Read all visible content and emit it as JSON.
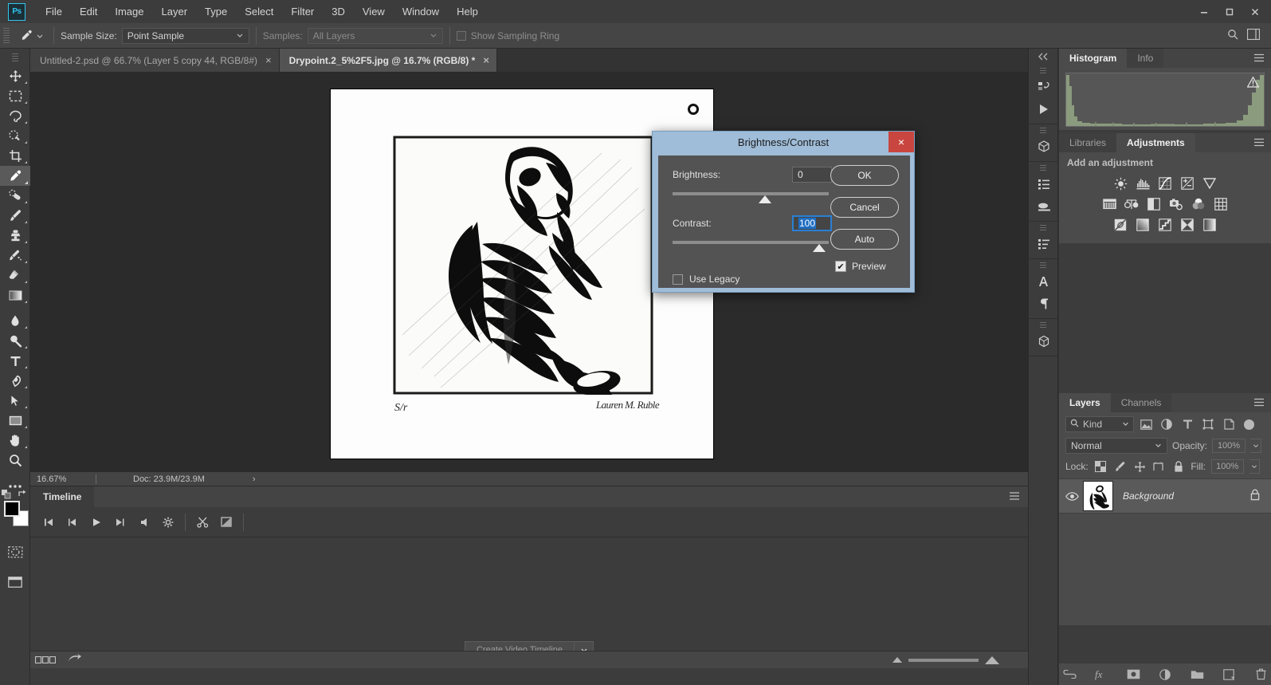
{
  "app": {
    "logo": "Ps",
    "menus": [
      "File",
      "Edit",
      "Image",
      "Layer",
      "Type",
      "Select",
      "Filter",
      "3D",
      "View",
      "Window",
      "Help"
    ],
    "window_controls": {
      "minimize": "minimize-icon",
      "maximize": "maximize-icon",
      "close": "close-icon"
    }
  },
  "options_bar": {
    "tool_icon": "eyedropper-icon",
    "sample_size_label": "Sample Size:",
    "sample_size_value": "Point Sample",
    "samples_label": "Samples:",
    "samples_value": "All Layers",
    "show_sampling_ring_label": "Show Sampling Ring",
    "show_sampling_ring_checked": false,
    "search_icon": "search-icon",
    "workspace_icon": "workspace-icon"
  },
  "toolbar": {
    "tools": [
      {
        "name": "move-tool",
        "icon": "move-icon",
        "active": false
      },
      {
        "name": "marquee-tool",
        "icon": "rectangular-marquee-icon",
        "active": false
      },
      {
        "name": "lasso-tool",
        "icon": "lasso-icon",
        "active": false
      },
      {
        "name": "quick-selection-tool",
        "icon": "quick-selection-icon",
        "active": false
      },
      {
        "name": "crop-tool",
        "icon": "crop-icon",
        "active": false
      },
      {
        "name": "eyedropper-tool",
        "icon": "eyedropper-icon",
        "active": true
      },
      {
        "name": "healing-brush-tool",
        "icon": "spot-healing-icon",
        "active": false
      },
      {
        "name": "brush-tool",
        "icon": "brush-icon",
        "active": false
      },
      {
        "name": "clone-stamp-tool",
        "icon": "clone-stamp-icon",
        "active": false
      },
      {
        "name": "history-brush-tool",
        "icon": "history-brush-icon",
        "active": false
      },
      {
        "name": "eraser-tool",
        "icon": "eraser-icon",
        "active": false
      },
      {
        "name": "gradient-tool",
        "icon": "gradient-icon",
        "active": false
      },
      {
        "name": "blur-tool",
        "icon": "blur-droplet-icon",
        "active": false
      },
      {
        "name": "dodge-tool",
        "icon": "dodge-icon",
        "active": false
      },
      {
        "name": "type-tool",
        "icon": "type-icon",
        "active": false
      },
      {
        "name": "pen-tool",
        "icon": "pen-icon",
        "active": false
      },
      {
        "name": "path-selection-tool",
        "icon": "path-selection-arrow-icon",
        "active": false
      },
      {
        "name": "rectangle-tool",
        "icon": "rectangle-shape-icon",
        "active": false
      },
      {
        "name": "hand-tool",
        "icon": "hand-icon",
        "active": false
      },
      {
        "name": "zoom-tool",
        "icon": "magnifier-icon",
        "active": false
      },
      {
        "name": "edit-toolbar-button",
        "icon": "ellipsis-icon",
        "active": false
      }
    ],
    "default_colors_icon": "default-colors-icon",
    "swap_colors_icon": "swap-colors-icon",
    "foreground_color": "#000000",
    "background_color": "#ffffff",
    "quick_mask_icon": "quick-mask-icon",
    "screen_mode_icon": "screen-mode-icon"
  },
  "document_tabs": [
    {
      "label": "Untitled-2.psd @ 66.7% (Layer 5 copy 44, RGB/8#)",
      "active": false,
      "close": "×"
    },
    {
      "label": "Drypoint.2_5%2F5.jpg @ 16.7% (RGB/8) *",
      "active": true,
      "close": "×"
    }
  ],
  "canvas": {
    "artwork_title": "drypoint-skeleton-print",
    "edition_mark": "S/r",
    "signature": "Lauren M. Ruble",
    "ring_mark": "registration-ring-mark"
  },
  "status_bar": {
    "zoom": "16.67%",
    "doc_size": "Doc: 23.9M/23.9M",
    "expand_arrow": "›"
  },
  "timeline": {
    "tab_label": "Timeline",
    "menu_icon": "panel-menu-icon",
    "transport": [
      {
        "name": "go-to-first-frame-button",
        "icon": "skip-start-icon"
      },
      {
        "name": "previous-frame-button",
        "icon": "step-back-icon"
      },
      {
        "name": "play-button",
        "icon": "play-icon"
      },
      {
        "name": "next-frame-button",
        "icon": "step-forward-icon"
      },
      {
        "name": "audio-mute-button",
        "icon": "speaker-icon"
      },
      {
        "name": "timeline-settings-button",
        "icon": "gear-icon"
      },
      {
        "name": "split-clip-button",
        "icon": "scissors-icon"
      },
      {
        "name": "transition-button",
        "icon": "transition-icon"
      }
    ],
    "create_button_label": "Create Video Timeline",
    "create_caret": "chevron-down-icon",
    "footer": {
      "frame_view_icon": "frame-view-icon",
      "convert_icon": "convert-to-frame-animation-icon",
      "zoom_out_icon": "zoom-out-triangle-icon",
      "zoom_in_icon": "zoom-in-triangle-icon"
    }
  },
  "icon_rail": {
    "collapse_icon": "collapse-panels-icon",
    "groups": [
      [
        "history-icon",
        "actions-play-icon"
      ],
      [
        "3d-cube-icon"
      ],
      [
        "layer-comps-icon",
        "brush-preset-icon"
      ],
      [
        "properties-list-icon"
      ],
      [
        "character-icon",
        "paragraph-icon"
      ],
      [
        "3d-scene-icon"
      ]
    ]
  },
  "histogram_panel": {
    "tabs": [
      {
        "label": "Histogram",
        "active": true
      },
      {
        "label": "Info",
        "active": false
      }
    ],
    "menu_icon": "panel-menu-icon",
    "warning_icon": "uncached-data-warning-icon"
  },
  "adjustments_panel": {
    "tabs": [
      {
        "label": "Libraries",
        "active": false
      },
      {
        "label": "Adjustments",
        "active": true
      }
    ],
    "menu_icon": "panel-menu-icon",
    "heading": "Add an adjustment",
    "rows": [
      [
        "brightness-contrast-icon",
        "levels-icon",
        "curves-icon",
        "exposure-icon",
        "vibrance-icon"
      ],
      [
        "hue-saturation-icon",
        "color-balance-icon",
        "black-white-icon",
        "photo-filter-icon",
        "channel-mixer-icon",
        "color-lookup-icon"
      ],
      [
        "invert-icon",
        "posterize-icon",
        "threshold-icon",
        "selective-color-icon",
        "gradient-map-icon"
      ]
    ]
  },
  "layers_panel": {
    "tabs": [
      {
        "label": "Layers",
        "active": true
      },
      {
        "label": "Channels",
        "active": false
      }
    ],
    "menu_icon": "panel-menu-icon",
    "filter_label": "Kind",
    "filter_icons": [
      "pixel-layer-filter-icon",
      "adjustment-layer-filter-icon",
      "type-layer-filter-icon",
      "shape-layer-filter-icon",
      "smart-object-filter-icon"
    ],
    "blend_mode": "Normal",
    "opacity_label": "Opacity:",
    "opacity_value": "100%",
    "lock_label": "Lock:",
    "lock_icons": [
      "lock-transparent-pixels-icon",
      "lock-image-pixels-icon",
      "lock-position-icon",
      "lock-artboard-icon",
      "lock-all-icon"
    ],
    "fill_label": "Fill:",
    "fill_value": "100%",
    "layers": [
      {
        "name": "Background",
        "visible": true,
        "locked": true,
        "eye_icon": "eye-icon",
        "lock_icon": "lock-icon",
        "thumbnail": "skeleton-thumbnail"
      }
    ],
    "footer_icons": [
      "link-layers-icon",
      "layer-style-fx-icon",
      "add-layer-mask-icon",
      "new-adjustment-layer-icon",
      "new-group-icon",
      "new-layer-icon",
      "delete-layer-icon"
    ]
  },
  "dialog": {
    "title": "Brightness/Contrast",
    "close_label": "×",
    "brightness_label": "Brightness:",
    "brightness_value": "0",
    "brightness_slider_pct": 60,
    "contrast_label": "Contrast:",
    "contrast_value": "100",
    "contrast_slider_pct": 98,
    "use_legacy_label": "Use Legacy",
    "use_legacy_checked": false,
    "preview_label": "Preview",
    "preview_checked": true,
    "preview_check_glyph": "✔",
    "buttons": [
      {
        "label": "OK",
        "name": "ok-button"
      },
      {
        "label": "Cancel",
        "name": "cancel-button"
      },
      {
        "label": "Auto",
        "name": "auto-button"
      }
    ]
  },
  "colors": {
    "chrome": "#3c3c3c",
    "panel": "#4b4b4b",
    "canvas_bg": "#2b2b2b",
    "dialog_titlebar": "#9fbcd8",
    "dialog_body": "#535353",
    "close_red": "#c9453f",
    "accent_blue": "#31c5f0",
    "selection_blue": "#1f6fc4"
  }
}
